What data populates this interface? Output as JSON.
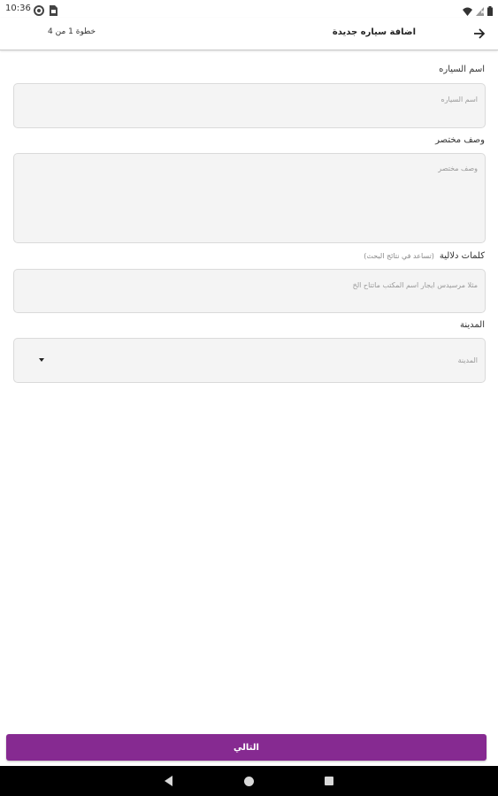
{
  "status_bar": {
    "time": "10:36",
    "icons": [
      "gps-icon",
      "sim-card-icon",
      "wifi-icon",
      "no-signal-icon",
      "battery-icon"
    ]
  },
  "app_bar": {
    "title": "اضافة سياره جديدة",
    "step": "خطوة 1 من 4",
    "back_icon": "arrow-right-icon"
  },
  "form": {
    "car_name": {
      "label": "اسم السياره",
      "placeholder": "اسم السياره"
    },
    "short_description": {
      "label": "وصف مختصر",
      "placeholder": "وصف مختصر"
    },
    "keywords": {
      "label": "كلمات دلالية",
      "hint": "(تساعد في نتائج البحث)",
      "placeholder": "مثلا مرسيدس ايجار اسم المكتب ماتتاح الخ"
    },
    "city": {
      "label": "المدينة",
      "placeholder": "المدينة",
      "icon": "dropdown-arrow-icon"
    }
  },
  "next_button": {
    "label": "التالي",
    "color": "#862a91"
  },
  "nav_bar": {
    "icons": [
      "back-triangle-icon",
      "home-circle-icon",
      "recents-square-icon"
    ]
  }
}
